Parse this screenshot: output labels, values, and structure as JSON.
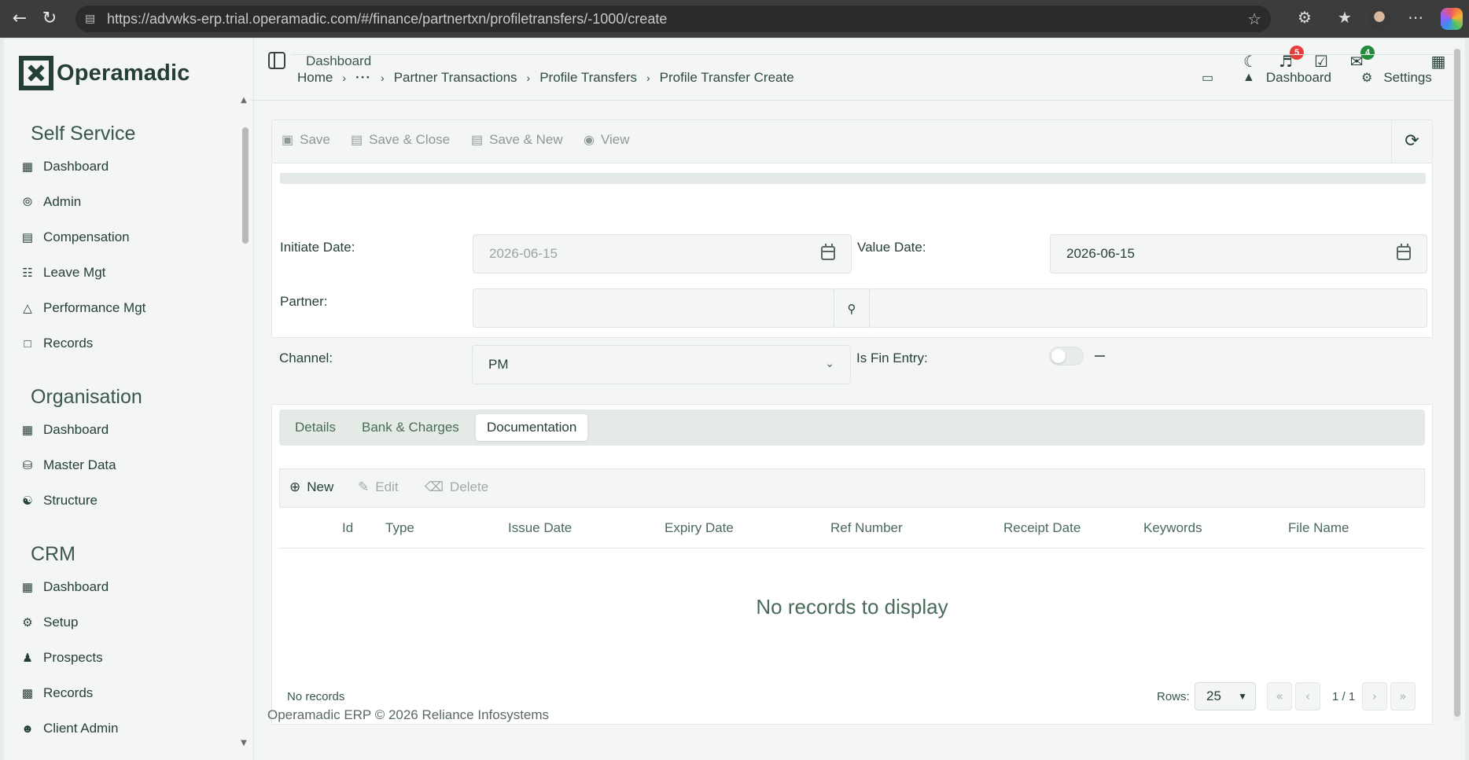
{
  "browser": {
    "url": "https://advwks-erp.trial.operamadic.com/#/finance/partnertxn/profiletransfers/-1000/create"
  },
  "app": {
    "brand": "Operamadic",
    "topbar_title": "Dashboard",
    "notifications_count": "5",
    "mail_count": "4",
    "footer": "Operamadic ERP © 2026 Reliance Infosystems"
  },
  "sidebar": {
    "sections": [
      {
        "title": "Self Service",
        "items": [
          {
            "label": "Dashboard",
            "icon": "dashboard-icon"
          },
          {
            "label": "Admin",
            "icon": "admin-icon"
          },
          {
            "label": "Compensation",
            "icon": "money-icon"
          },
          {
            "label": "Leave Mgt",
            "icon": "calendar-icon"
          },
          {
            "label": "Performance Mgt",
            "icon": "chart-icon"
          },
          {
            "label": "Records",
            "icon": "file-icon"
          }
        ]
      },
      {
        "title": "Organisation",
        "items": [
          {
            "label": "Dashboard",
            "icon": "dashboard-icon"
          },
          {
            "label": "Master Data",
            "icon": "database-icon"
          },
          {
            "label": "Structure",
            "icon": "sitemap-icon"
          }
        ]
      },
      {
        "title": "CRM",
        "items": [
          {
            "label": "Dashboard",
            "icon": "dashboard-icon"
          },
          {
            "label": "Setup",
            "icon": "gears-icon"
          },
          {
            "label": "Prospects",
            "icon": "user-plus-icon"
          },
          {
            "label": "Records",
            "icon": "contact-book-icon"
          },
          {
            "label": "Client Admin",
            "icon": "user-gear-icon"
          }
        ]
      }
    ]
  },
  "breadcrumb": {
    "items": [
      "Home",
      "···",
      "Partner Transactions",
      "Profile Transfers",
      "Profile Transfer Create"
    ],
    "right_dashboard": "Dashboard",
    "right_settings": "Settings"
  },
  "toolbar": {
    "save": "Save",
    "save_close": "Save & Close",
    "save_new": "Save & New",
    "view": "View"
  },
  "form": {
    "initiate_date_label": "Initiate Date:",
    "initiate_date_value": "2026-06-15",
    "value_date_label": "Value Date:",
    "value_date_value": "2026-06-15",
    "partner_label": "Partner:",
    "partner_code": "",
    "partner_name": "",
    "channel_label": "Channel:",
    "channel_value": "PM",
    "is_fin_entry_label": "Is Fin Entry:",
    "is_fin_entry_value": false
  },
  "tabs": [
    "Details",
    "Bank & Charges",
    "Documentation"
  ],
  "active_tab": "Documentation",
  "table": {
    "toolbar": {
      "new": "New",
      "edit": "Edit",
      "delete": "Delete"
    },
    "columns": [
      "Id",
      "Type",
      "Issue Date",
      "Expiry Date",
      "Ref Number",
      "Receipt Date",
      "Keywords",
      "File Name"
    ],
    "rows": [],
    "empty_message": "No records to display",
    "footer_status": "No records",
    "rows_label": "Rows:",
    "rows_per_page": "25",
    "page_info": "1 / 1"
  }
}
